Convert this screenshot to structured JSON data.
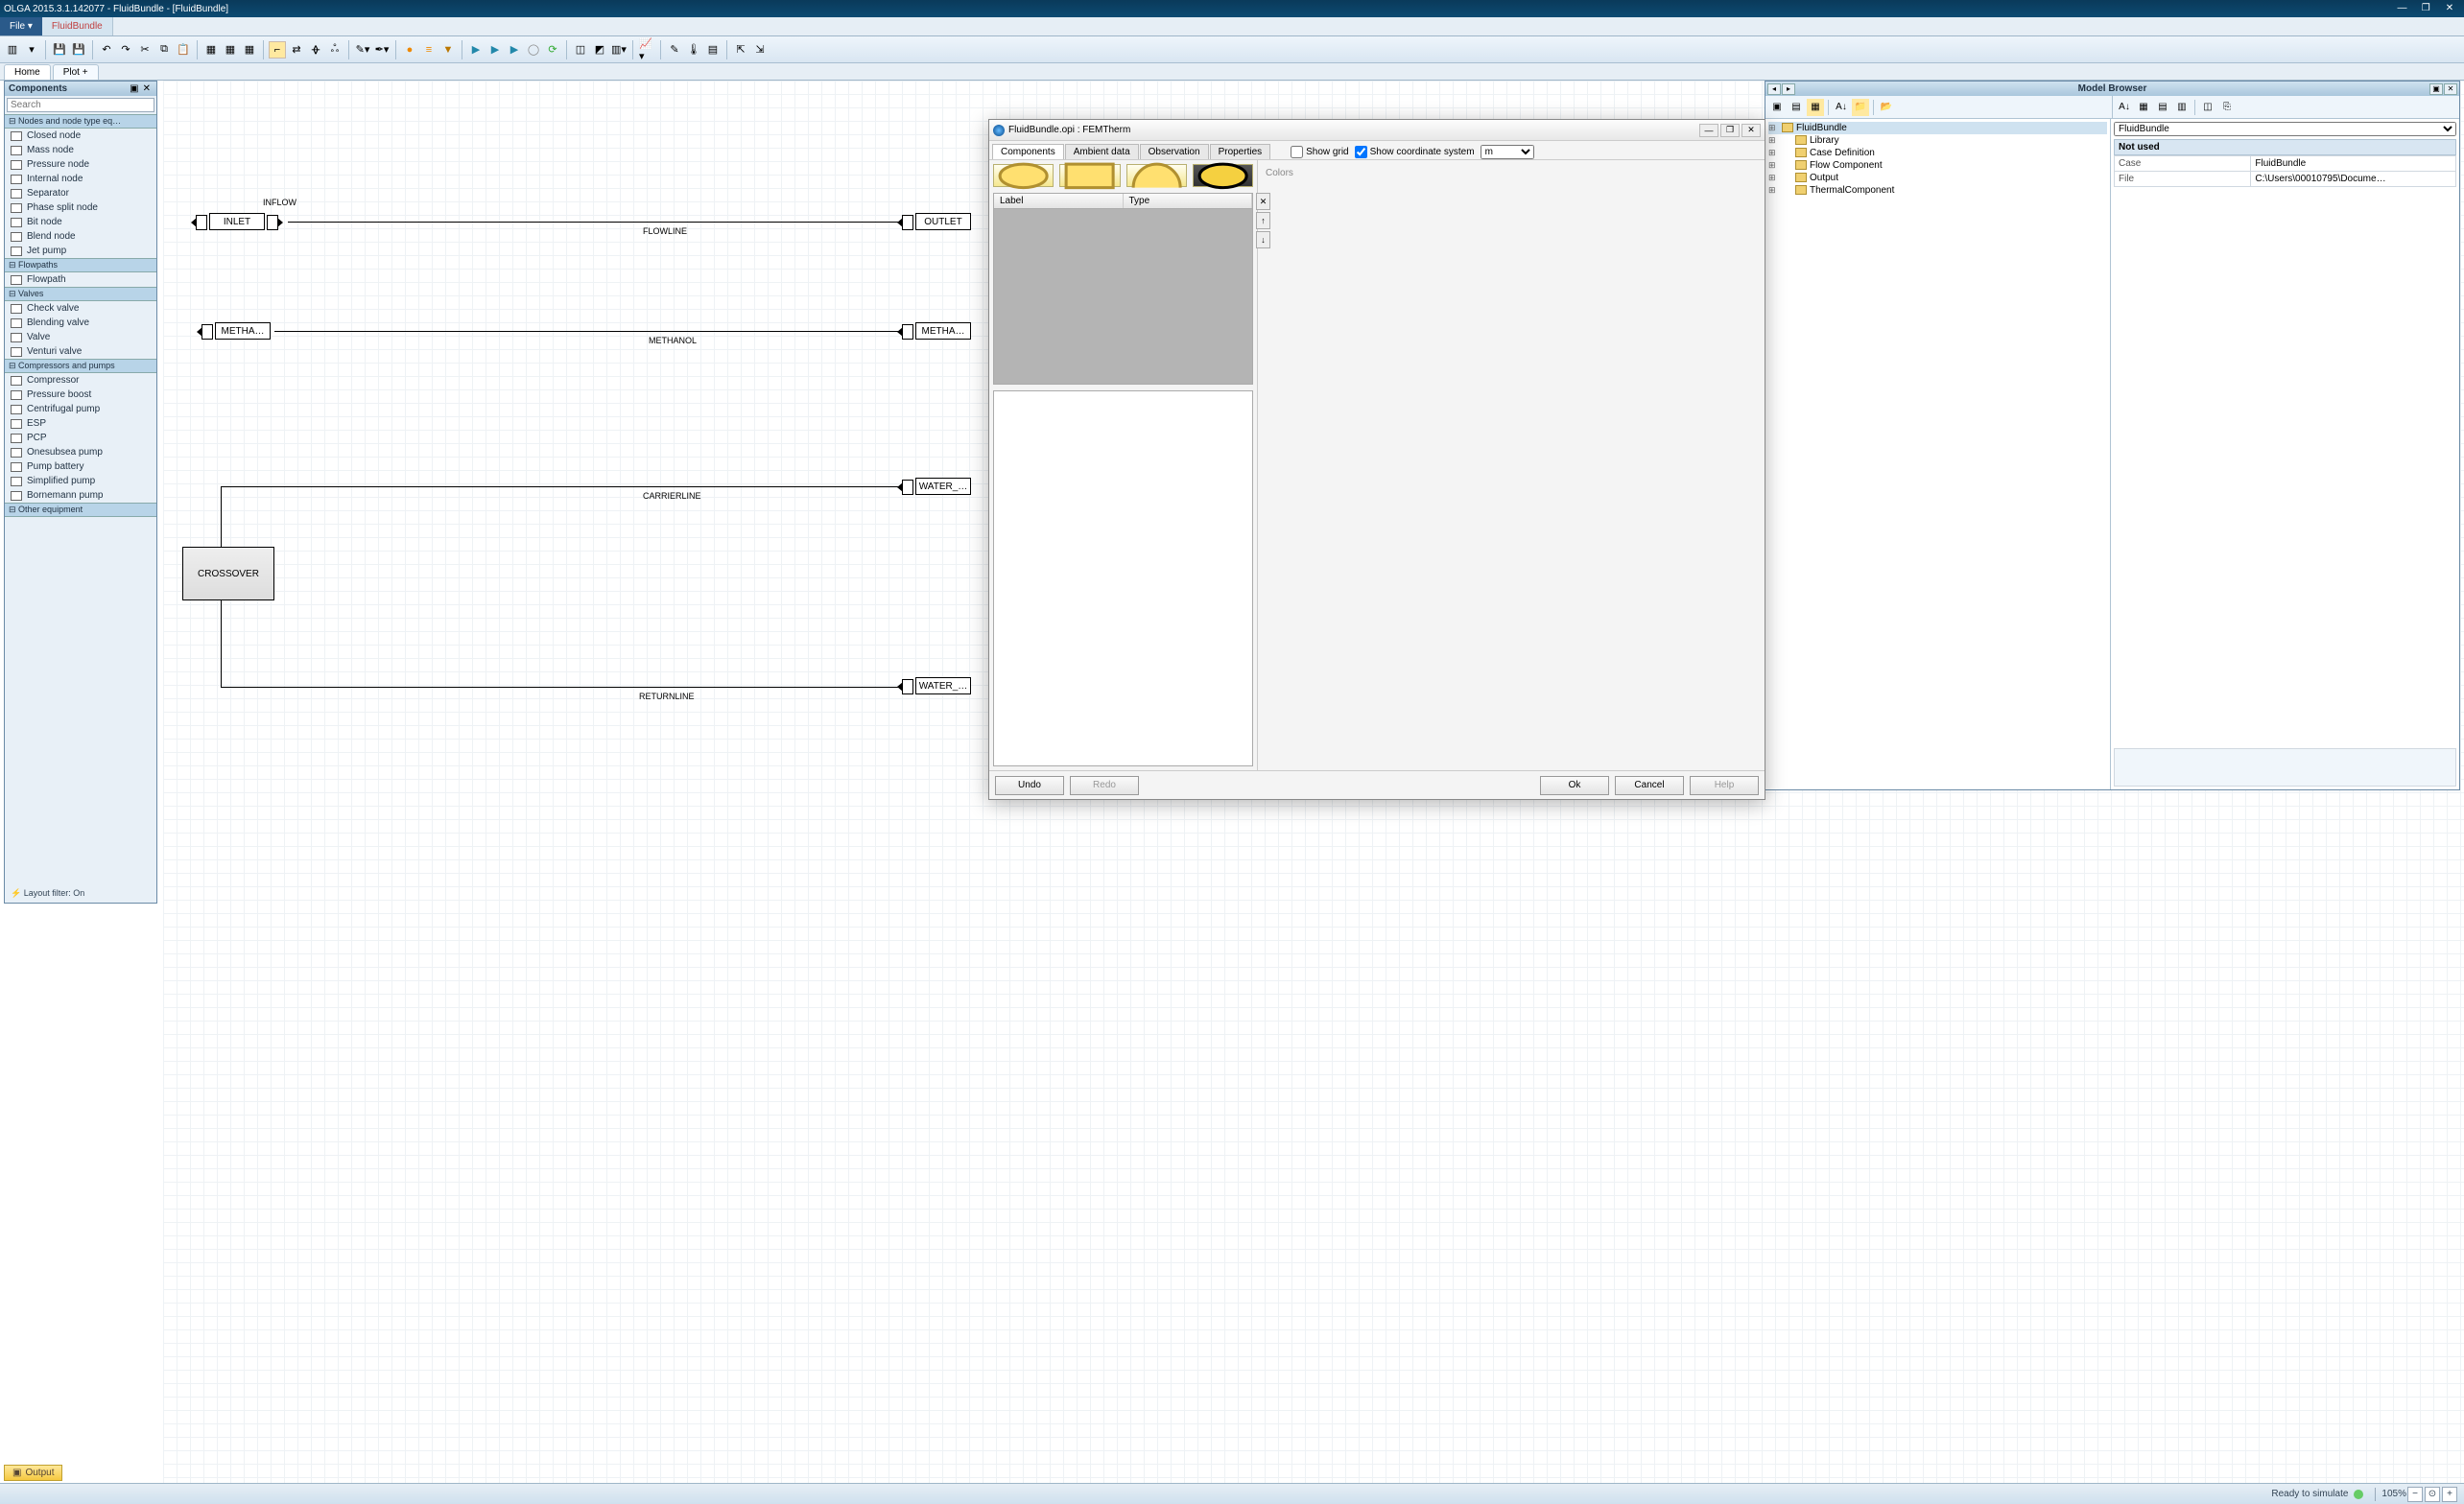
{
  "title": "OLGA 2015.3.1.142077 - FluidBundle - [FluidBundle]",
  "menu": {
    "file": "File ▾",
    "tab": "FluidBundle"
  },
  "subtabs": {
    "home": "Home",
    "plot": "Plot  +"
  },
  "components_panel": {
    "title": "Components",
    "search_placeholder": "Search",
    "sections": {
      "nodes": "Nodes and node type eq…",
      "flowpaths": "Flowpaths",
      "valves": "Valves",
      "compressors": "Compressors and pumps",
      "other": "Other equipment"
    },
    "nodes_items": [
      "Closed node",
      "Mass node",
      "Pressure node",
      "Internal node",
      "Separator",
      "Phase split node",
      "Bit node",
      "Blend node",
      "Jet pump"
    ],
    "flowpaths_items": [
      "Flowpath"
    ],
    "valves_items": [
      "Check valve",
      "Blending valve",
      "Valve",
      "Venturi valve"
    ],
    "comp_items": [
      "Compressor",
      "Pressure boost",
      "Centrifugal pump",
      "ESP",
      "PCP",
      "Onesubsea pump",
      "Pump battery",
      "Simplified pump",
      "Bornemann pump"
    ]
  },
  "canvas": {
    "inflow": "INFLOW",
    "inlet": "INLET",
    "outlet": "OUTLET",
    "flowline": "FLOWLINE",
    "metha_l": "METHA…",
    "metha_r": "METHA…",
    "methanol": "METHANOL",
    "carrierline": "CARRIERLINE",
    "water_top": "WATER_…",
    "water_bot": "WATER_…",
    "returnline": "RETURNLINE",
    "crossover": "CROSSOVER",
    "footer": "⚡ Layout filter: On"
  },
  "dialog": {
    "title": "FluidBundle.opi : FEMTherm",
    "tabs": [
      "Components",
      "Ambient data",
      "Observation",
      "Properties"
    ],
    "show_grid": "Show grid",
    "show_coord": "Show coordinate system",
    "coord_unit": "m",
    "table_cols": [
      "Label",
      "Type"
    ],
    "side_btns": [
      "✕",
      "↑",
      "↓"
    ],
    "colors_label": "Colors",
    "buttons": {
      "undo": "Undo",
      "redo": "Redo",
      "ok": "Ok",
      "cancel": "Cancel",
      "help": "Help"
    }
  },
  "model_browser": {
    "title": "Model Browser",
    "dropdown": "FluidBundle",
    "tree": [
      {
        "label": "FluidBundle",
        "level": 0,
        "sel": true
      },
      {
        "label": "Library",
        "level": 1
      },
      {
        "label": "Case Definition",
        "level": 1
      },
      {
        "label": "Flow Component",
        "level": 1
      },
      {
        "label": "Output",
        "level": 1
      },
      {
        "label": "ThermalComponent",
        "level": 1
      }
    ],
    "props_header": "Not used",
    "props": [
      {
        "k": "Case",
        "v": "FluidBundle"
      },
      {
        "k": "File",
        "v": "C:\\Users\\00010795\\Docume…"
      }
    ]
  },
  "output_tab": "Output",
  "status": {
    "ready": "Ready to simulate",
    "zoom": "105%"
  }
}
